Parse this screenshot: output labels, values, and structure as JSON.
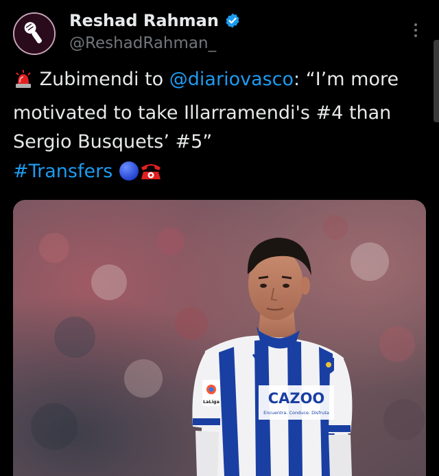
{
  "author": {
    "display_name": "Reshad Rahman",
    "handle": "@ReshadRahman_",
    "verified_icon": "verified-badge-icon",
    "avatar_icon": "microphone-icon"
  },
  "tweet": {
    "siren_emoji_icon": "police-light-icon",
    "text_before_mention": "Zubimendi to ",
    "mention": "@diariovasco",
    "text_after_mention": ": “I’m more motivated to take Illarramendi's #4 than Sergio Busquets’ #5”",
    "hashtag": "#Transfers",
    "trailing_emojis": [
      "blue-circle-icon",
      "telephone-icon"
    ]
  },
  "media": {
    "sponsor_text": "CAZOO",
    "sponsor_tagline": "Encuentra. Conduce. Disfruta",
    "league_badge_text": "LaLiga"
  },
  "colors": {
    "background": "#000000",
    "text": "#e7e9ea",
    "secondary": "#71767b",
    "link": "#1d9bf0",
    "verified": "#1d9bf0"
  },
  "icons": {
    "more": "more-vertical-icon"
  }
}
